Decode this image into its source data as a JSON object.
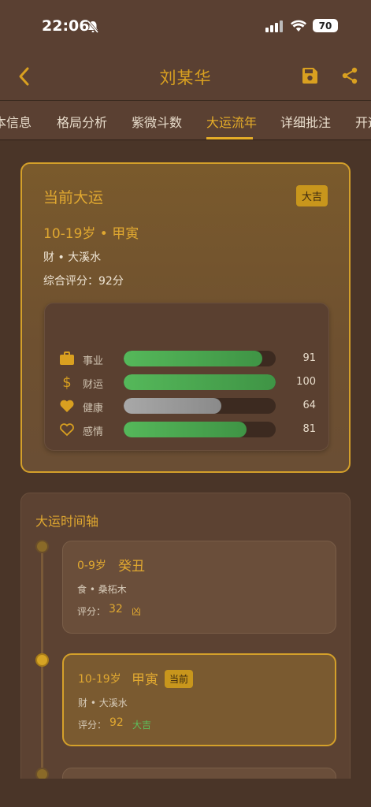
{
  "status": {
    "time": "22:06",
    "battery": "70"
  },
  "nav": {
    "title": "刘某华"
  },
  "tabs": [
    {
      "label": "本信息"
    },
    {
      "label": "格局分析"
    },
    {
      "label": "紫微斗数"
    },
    {
      "label": "大运流年"
    },
    {
      "label": "详细批注"
    },
    {
      "label": "开运"
    }
  ],
  "active_tab": "大运流年",
  "current": {
    "title": "当前大运",
    "badge": "大吉",
    "period": "10-19岁 • 甲寅",
    "element": "财 • 大溪水",
    "score_text": "综合评分：92分",
    "metrics": [
      {
        "label": "事业",
        "value": "91",
        "fill": 0.91,
        "icon": "briefcase-icon"
      },
      {
        "label": "财运",
        "value": "100",
        "fill": 1.0,
        "icon": "dollar-icon"
      },
      {
        "label": "健康",
        "value": "64",
        "fill": 0.64,
        "icon": "heart-filled-icon"
      },
      {
        "label": "感情",
        "value": "81",
        "fill": 0.81,
        "icon": "heart-outline-icon"
      }
    ]
  },
  "timeline": {
    "title": "大运时间轴",
    "items": [
      {
        "age": "0-9岁",
        "gz": "癸丑",
        "element": "食 • 桑柘木",
        "score_label": "评分：",
        "score": "32",
        "verdict": "凶",
        "verdict_color": "#e0a830",
        "current": false
      },
      {
        "age": "10-19岁",
        "gz": "甲寅",
        "element": "财 • 大溪水",
        "score_label": "评分：",
        "score": "92",
        "verdict": "大吉",
        "verdict_color": "#5cbf5c",
        "current": true,
        "current_label": "当前"
      }
    ]
  },
  "colors": {
    "accent": "#e0a830",
    "background": "#4a3528",
    "good": "#5cbf5c"
  }
}
